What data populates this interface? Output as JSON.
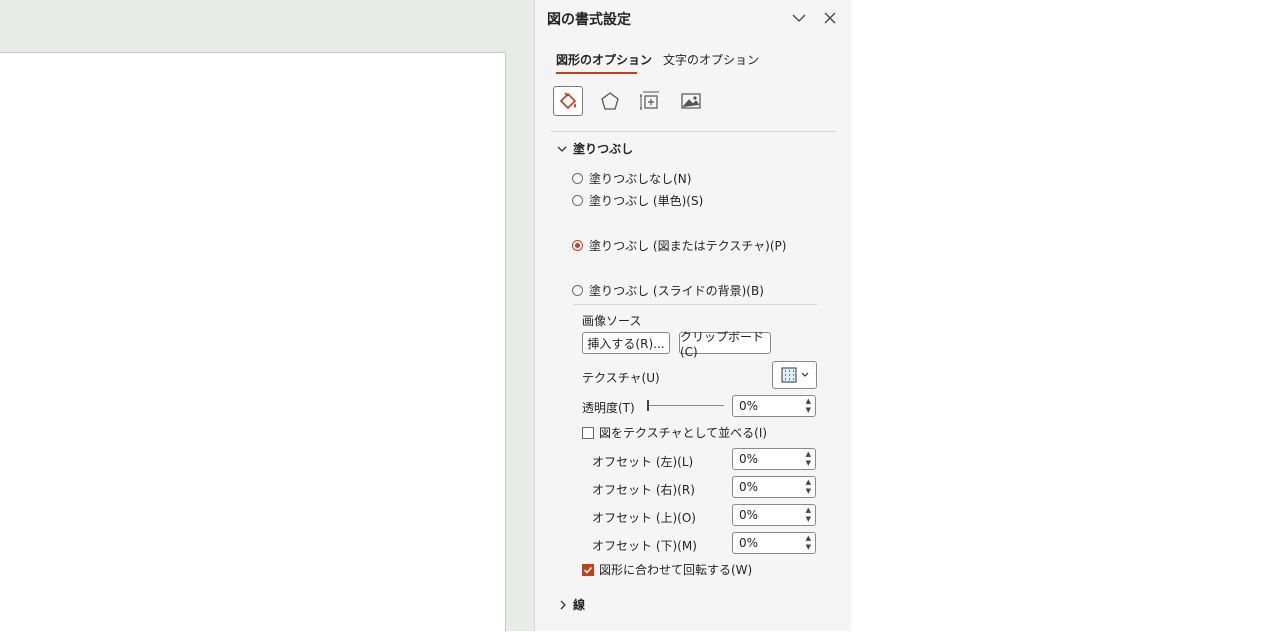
{
  "pane": {
    "title": "図の書式設定",
    "tabs": [
      {
        "label": "図形のオプション",
        "active": true
      },
      {
        "label": "文字のオプション",
        "active": false
      }
    ],
    "categories": [
      "fill-line-icon",
      "effects-pentagon-icon",
      "size-properties-icon",
      "picture-icon"
    ]
  },
  "fill": {
    "section_label": "塗りつぶし",
    "options": [
      {
        "label": "塗りつぶしなし(N)",
        "checked": false
      },
      {
        "label": "塗りつぶし (単色)(S)",
        "checked": false
      },
      {
        "label": "塗りつぶし (図またはテクスチャ)(P)",
        "checked": true
      },
      {
        "label": "塗りつぶし (スライドの背景)(B)",
        "checked": false
      }
    ],
    "image_source_label": "画像ソース",
    "insert_button": "挿入する(R)...",
    "clipboard_button": "クリップボード(C)",
    "texture_label": "テクスチャ(U)",
    "transparency_label": "透明度(T)",
    "transparency_value": "0%",
    "transparency_fraction": 0,
    "tile_label": "図をテクスチャとして並べる(I)",
    "tile_checked": false,
    "offsets": [
      {
        "label": "オフセット (左)(L)",
        "value": "0%"
      },
      {
        "label": "オフセット (右)(R)",
        "value": "0%"
      },
      {
        "label": "オフセット (上)(O)",
        "value": "0%"
      },
      {
        "label": "オフセット (下)(M)",
        "value": "0%"
      }
    ],
    "rotate_label": "図形に合わせて回転する(W)",
    "rotate_checked": true
  },
  "line": {
    "section_label": "線"
  },
  "colors": {
    "accent": "#c43e1c",
    "highlight": "#e64a33"
  }
}
